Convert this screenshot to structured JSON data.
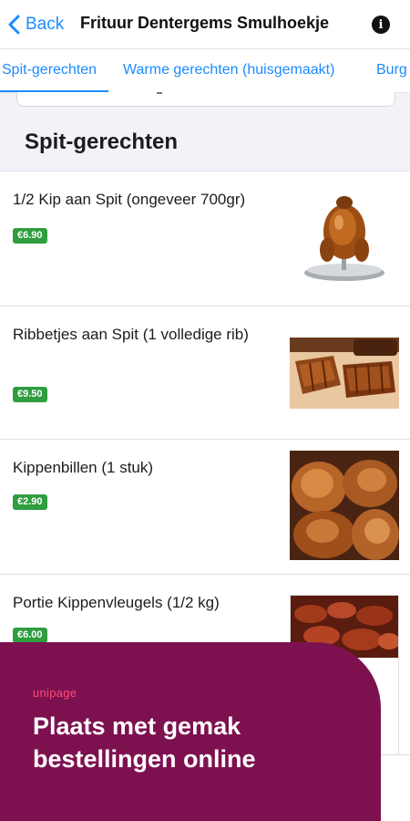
{
  "header": {
    "back_label": "Back",
    "title": "Frituur Dentergems Smulhoekje",
    "info_icon": "i"
  },
  "tabs": [
    {
      "label": "Spit-gerechten",
      "active": true
    },
    {
      "label": "Warme gerechten (huisgemaakt)",
      "active": false
    },
    {
      "label": "Burg",
      "active": false
    }
  ],
  "section": {
    "title": "Spit-gerechten"
  },
  "items": [
    {
      "name": "1/2 Kip aan Spit (ongeveer 700gr)",
      "price": "€6.90",
      "image": "roast-chicken-on-stand"
    },
    {
      "name": "Ribbetjes aan Spit (1 volledige rib)",
      "price": "€9.50",
      "image": "spare-ribs"
    },
    {
      "name": "Kippenbillen (1 stuk)",
      "price": "€2.90",
      "image": "chicken-legs"
    },
    {
      "name": "Portie Kippenvleugels (1/2 kg)",
      "price": "€6.00",
      "image": "chicken-wings"
    }
  ],
  "promo": {
    "logo": "unipage",
    "text": "Plaats met gemak bestellingen online"
  },
  "colors": {
    "accent": "#1a8cff",
    "price_badge": "#2e9e3e",
    "promo_bg": "#7d1150",
    "promo_logo": "#ff4b73"
  }
}
